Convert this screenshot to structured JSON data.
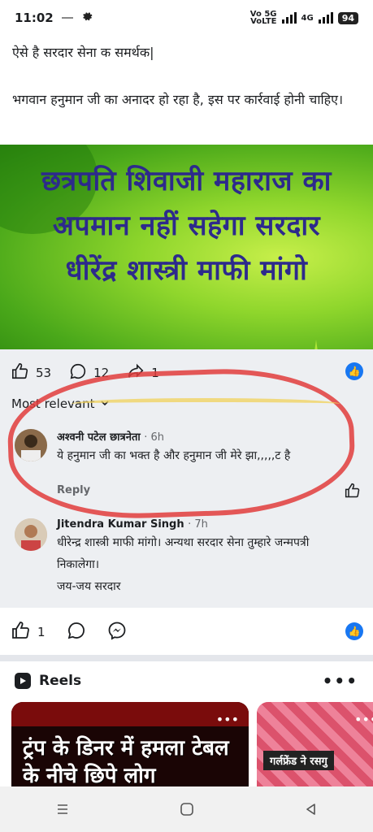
{
  "status_bar": {
    "time": "11:02",
    "network_1": "Vo 5G",
    "network_1_sub": "VoLTE",
    "network_2": "4G",
    "battery": "94"
  },
  "post": {
    "line1": "ऐसे है सरदार सेना क समर्थक|",
    "line2": "भगवान हनुमान जी का अनादर हो रहा है, इस पर कार्रवाई होनी चाहिए।"
  },
  "banner": {
    "lines": [
      "छत्रपति शिवाजी महाराज का",
      "अपमान नहीं सहेगा सरदार",
      "धीरेंद्र शास्त्री माफी मांगो"
    ]
  },
  "reactions": {
    "likes": "53",
    "comments": "12",
    "shares": "1"
  },
  "filter_label": "Most relevant",
  "comments": [
    {
      "name": "अश्वनी पटेल छात्रनेता",
      "time": "· 6h",
      "text": "ये हनुमान जी का भक्त है और हनुमान जी मेरे झा,,,,,ट है",
      "reply_label": "Reply"
    },
    {
      "name": "Jitendra Kumar Singh",
      "time": "· 7h",
      "text": "धीरेन्द्र शास्त्री माफी मांगो। अन्यथा सरदार सेना तुम्हारे जन्मपत्री निकालेगा।",
      "text2": "जय-जय सरदार"
    }
  ],
  "post2": {
    "likes": "1"
  },
  "reels": {
    "title": "Reels",
    "more": "•••",
    "reel1_title": "ट्रंप के डिनर में हमला टेबल के नीचे छिपे लोग",
    "reel2_caption": "गर्लफ्रेंड ने रसगु"
  },
  "colors": {
    "facebook_blue": "#1877f2",
    "banner_text": "#2d2a8c",
    "annotation_red": "#e03c3c"
  }
}
